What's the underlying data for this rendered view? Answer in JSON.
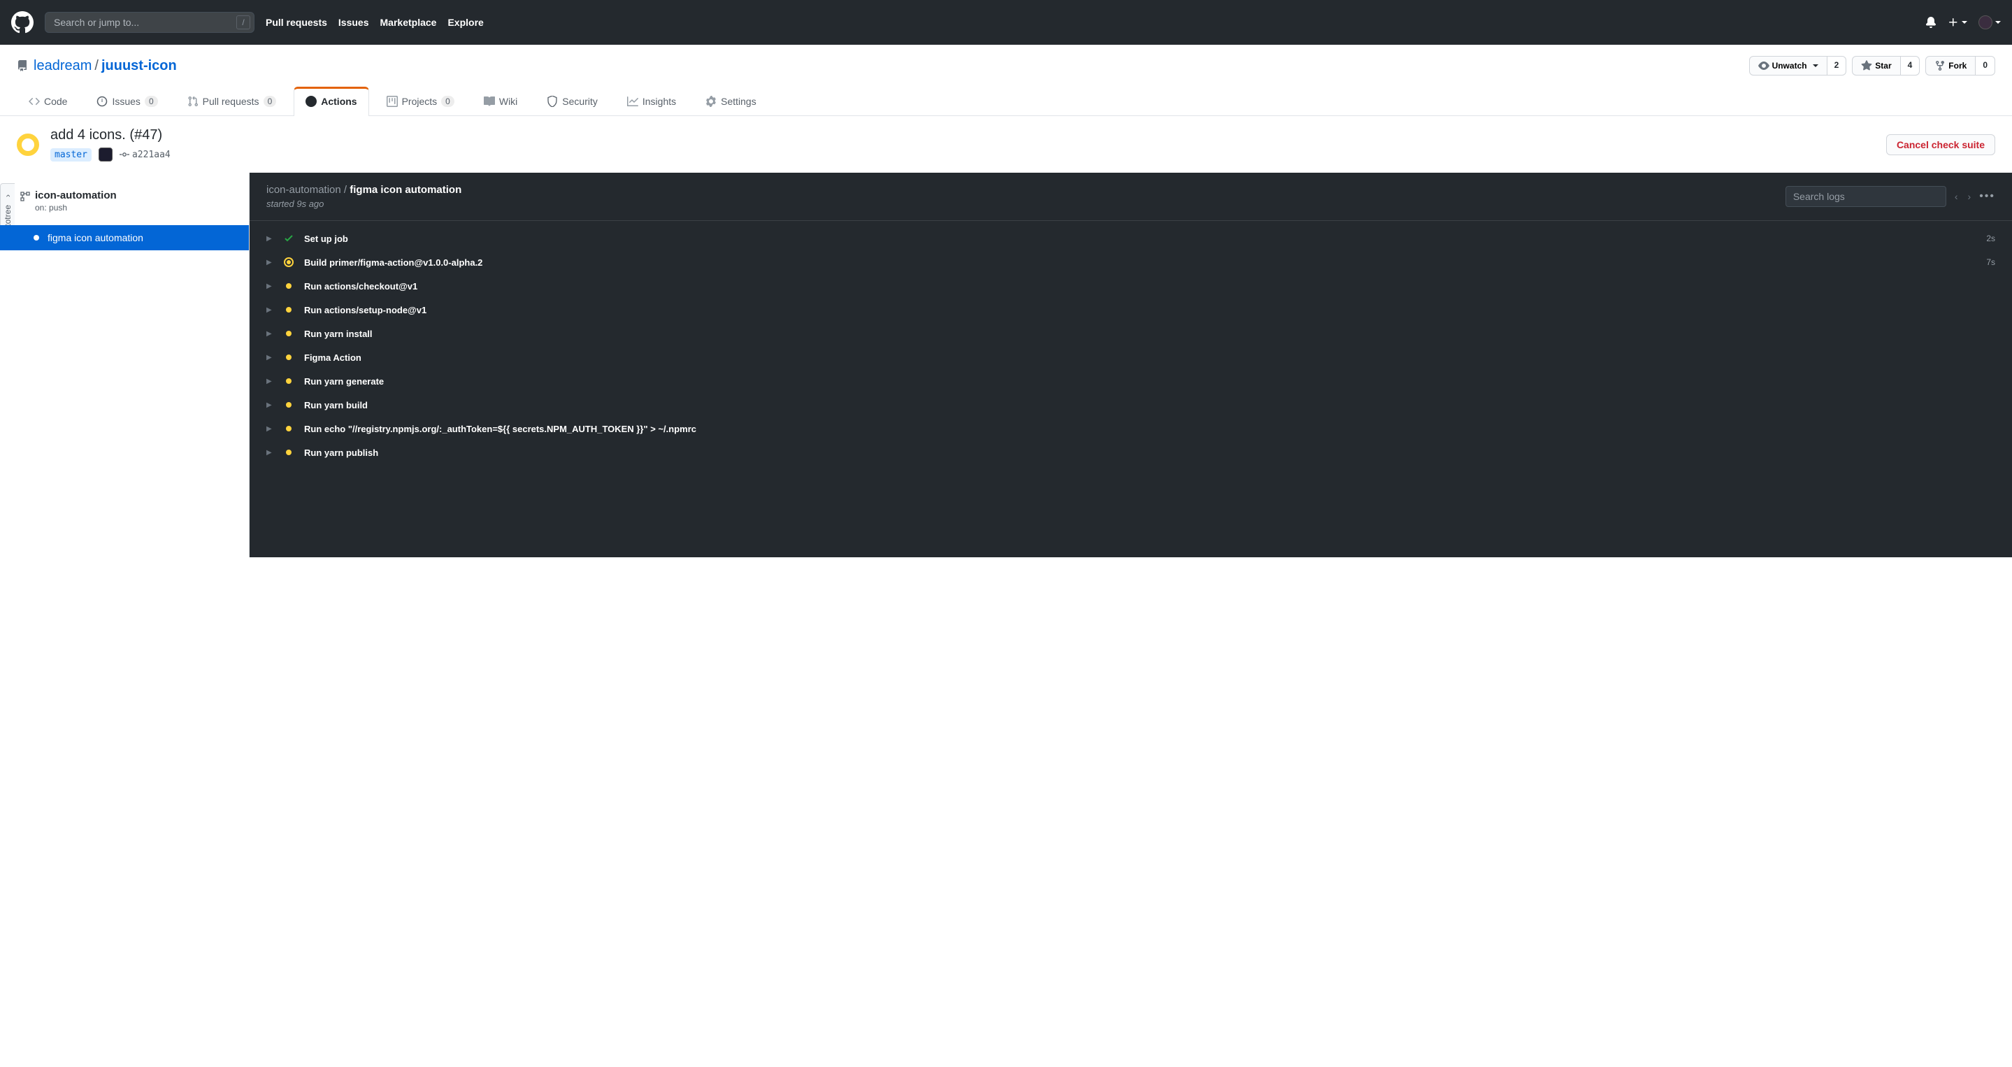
{
  "topbar": {
    "search_placeholder": "Search or jump to...",
    "nav": {
      "pull_requests": "Pull requests",
      "issues": "Issues",
      "marketplace": "Marketplace",
      "explore": "Explore"
    }
  },
  "repo": {
    "owner": "leadream",
    "name": "juuust-icon",
    "actions": {
      "unwatch": "Unwatch",
      "unwatch_count": "2",
      "star": "Star",
      "star_count": "4",
      "fork": "Fork",
      "fork_count": "0"
    }
  },
  "tabs": {
    "code": "Code",
    "issues": "Issues",
    "issues_count": "0",
    "prs": "Pull requests",
    "prs_count": "0",
    "actions": "Actions",
    "projects": "Projects",
    "projects_count": "0",
    "wiki": "Wiki",
    "security": "Security",
    "insights": "Insights",
    "settings": "Settings"
  },
  "run": {
    "title": "add 4 icons. (#47)",
    "branch": "master",
    "sha": "a221aa4",
    "cancel": "Cancel check suite"
  },
  "sidebar": {
    "workflow_name": "icon-automation",
    "trigger": "on: push",
    "job": "figma icon automation"
  },
  "octotree": "Octotree",
  "logs": {
    "breadcrumb_workflow": "icon-automation",
    "breadcrumb_sep": " / ",
    "breadcrumb_job": "figma icon automation",
    "started": "started 9s ago",
    "search_placeholder": "Search logs",
    "steps": [
      {
        "status": "success",
        "name": "Set up job",
        "time": "2s"
      },
      {
        "status": "running",
        "name": "Build primer/figma-action@v1.0.0-alpha.2",
        "time": "7s"
      },
      {
        "status": "pending",
        "name": "Run actions/checkout@v1",
        "time": ""
      },
      {
        "status": "pending",
        "name": "Run actions/setup-node@v1",
        "time": ""
      },
      {
        "status": "pending",
        "name": "Run yarn install",
        "time": ""
      },
      {
        "status": "pending",
        "name": "Figma Action",
        "time": ""
      },
      {
        "status": "pending",
        "name": "Run yarn generate",
        "time": ""
      },
      {
        "status": "pending",
        "name": "Run yarn build",
        "time": ""
      },
      {
        "status": "pending",
        "name": "Run echo \"//registry.npmjs.org/:_authToken=${{ secrets.NPM_AUTH_TOKEN }}\" > ~/.npmrc",
        "time": ""
      },
      {
        "status": "pending",
        "name": "Run yarn publish",
        "time": ""
      }
    ]
  }
}
